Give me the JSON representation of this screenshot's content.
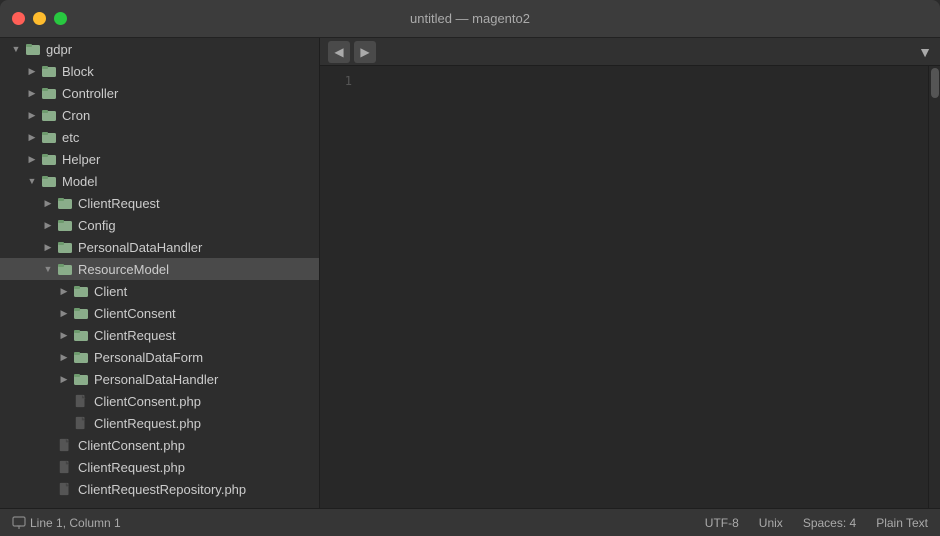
{
  "titlebar": {
    "title": "untitled — magento2",
    "buttons": {
      "close": "close",
      "minimize": "minimize",
      "maximize": "maximize"
    }
  },
  "sidebar": {
    "items": [
      {
        "id": "gdpr",
        "label": "gdpr",
        "type": "folder",
        "indent": 1,
        "state": "expanded",
        "selected": false
      },
      {
        "id": "block",
        "label": "Block",
        "type": "folder",
        "indent": 2,
        "state": "collapsed",
        "selected": false
      },
      {
        "id": "controller",
        "label": "Controller",
        "type": "folder",
        "indent": 2,
        "state": "collapsed",
        "selected": false
      },
      {
        "id": "cron",
        "label": "Cron",
        "type": "folder",
        "indent": 2,
        "state": "collapsed",
        "selected": false
      },
      {
        "id": "etc",
        "label": "etc",
        "type": "folder",
        "indent": 2,
        "state": "collapsed",
        "selected": false
      },
      {
        "id": "helper",
        "label": "Helper",
        "type": "folder",
        "indent": 2,
        "state": "collapsed",
        "selected": false
      },
      {
        "id": "model",
        "label": "Model",
        "type": "folder",
        "indent": 2,
        "state": "expanded",
        "selected": false
      },
      {
        "id": "clientrequest1",
        "label": "ClientRequest",
        "type": "folder",
        "indent": 3,
        "state": "collapsed",
        "selected": false
      },
      {
        "id": "config",
        "label": "Config",
        "type": "folder",
        "indent": 3,
        "state": "collapsed",
        "selected": false
      },
      {
        "id": "personaldatahandler1",
        "label": "PersonalDataHandler",
        "type": "folder",
        "indent": 3,
        "state": "collapsed",
        "selected": false
      },
      {
        "id": "resourcemodel",
        "label": "ResourceModel",
        "type": "folder",
        "indent": 3,
        "state": "expanded",
        "selected": true
      },
      {
        "id": "client",
        "label": "Client",
        "type": "folder",
        "indent": 4,
        "state": "collapsed",
        "selected": false
      },
      {
        "id": "clientconsent",
        "label": "ClientConsent",
        "type": "folder",
        "indent": 4,
        "state": "collapsed",
        "selected": false
      },
      {
        "id": "clientrequest2",
        "label": "ClientRequest",
        "type": "folder",
        "indent": 4,
        "state": "collapsed",
        "selected": false
      },
      {
        "id": "personaldataform",
        "label": "PersonalDataForm",
        "type": "folder",
        "indent": 4,
        "state": "collapsed",
        "selected": false
      },
      {
        "id": "personaldatahandler2",
        "label": "PersonalDataHandler",
        "type": "folder",
        "indent": 4,
        "state": "collapsed",
        "selected": false
      },
      {
        "id": "clientconsent_php1",
        "label": "ClientConsent.php",
        "type": "file",
        "indent": 4,
        "state": "leaf",
        "selected": false
      },
      {
        "id": "clientrequest_php1",
        "label": "ClientRequest.php",
        "type": "file",
        "indent": 4,
        "state": "leaf",
        "selected": false
      },
      {
        "id": "clientconsent_php2",
        "label": "ClientConsent.php",
        "type": "file",
        "indent": 3,
        "state": "leaf",
        "selected": false
      },
      {
        "id": "clientrequest_php2",
        "label": "ClientRequest.php",
        "type": "file",
        "indent": 3,
        "state": "leaf",
        "selected": false
      },
      {
        "id": "clientrequestrepo_php",
        "label": "ClientRequestRepository.php",
        "type": "file",
        "indent": 3,
        "state": "leaf",
        "selected": false
      }
    ]
  },
  "editor": {
    "toolbar": {
      "prev_label": "◀",
      "next_label": "▶",
      "dropdown_label": "▼"
    },
    "line_numbers": [
      "1"
    ]
  },
  "statusbar": {
    "position": "Line 1, Column 1",
    "encoding": "UTF-8",
    "line_ending": "Unix",
    "indentation": "Spaces: 4",
    "syntax": "Plain Text",
    "monitor_icon": "monitor"
  }
}
